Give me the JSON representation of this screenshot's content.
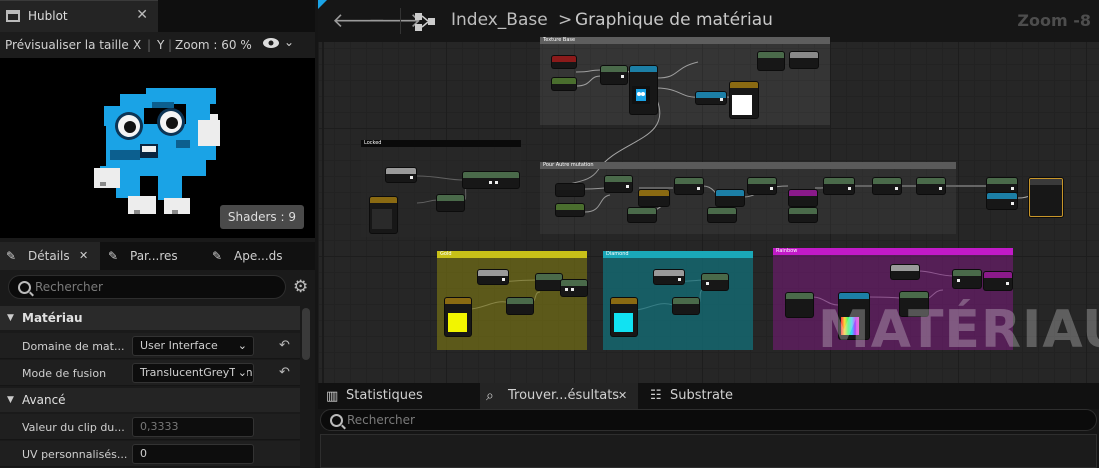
{
  "viewport_tab": {
    "title": "Hublot",
    "close": "✕"
  },
  "preview_toolbar": {
    "preview_size": "Prévisualiser la taille",
    "x": "X",
    "y": "Y",
    "zoom": "Zoom : 60 %"
  },
  "preview": {
    "shaders": "Shaders : 9"
  },
  "details_tabs": [
    {
      "label": "Détails",
      "close": "✕"
    },
    {
      "label": "Par...res"
    },
    {
      "label": "Ape...ds"
    }
  ],
  "details_search": {
    "placeholder": "Rechercher"
  },
  "sections": {
    "material": "Matériau",
    "advanced": "Avancé"
  },
  "properties": [
    {
      "label": "Domaine de mat...",
      "value": "User Interface"
    },
    {
      "label": "Mode de fusion",
      "value": "TranslucentGreyTran"
    },
    {
      "label": "Valeur du clip du...",
      "value": "0,3333"
    },
    {
      "label": "UV personnalisés...",
      "value": "0"
    }
  ],
  "graph": {
    "breadcrumb_root": "Index_Base",
    "breadcrumb_sep": ">",
    "breadcrumb_page": "Graphique de matériau",
    "zoom": "Zoom -8",
    "watermark": "MATÉRIAU",
    "comments": [
      "Texture Base",
      "Locked",
      "Pour Autre mutation",
      "Gold",
      "Diamond",
      "Rainbow"
    ]
  },
  "bottom_tabs": [
    {
      "label": "Statistiques"
    },
    {
      "label": "Trouver...ésultats",
      "close": "✕"
    },
    {
      "label": "Substrate"
    }
  ],
  "bottom_search": {
    "placeholder": "Rechercher"
  },
  "colors": {
    "accent_blue": "#1aa3e6",
    "gold": "#7a7414",
    "diamond": "#137079",
    "rainbow": "#7b1a7e",
    "swatch_yellow": "#f2f500",
    "swatch_cyan": "#11e2f2"
  }
}
